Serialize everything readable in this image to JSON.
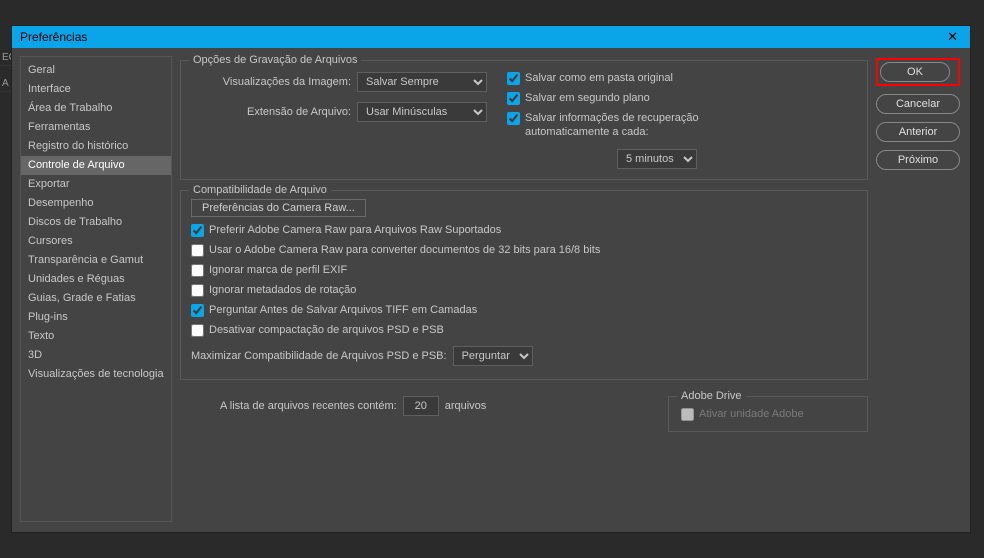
{
  "dialog": {
    "title": "Preferências"
  },
  "sidebar": {
    "items": [
      "Geral",
      "Interface",
      "Área de Trabalho",
      "Ferramentas",
      "Registro do histórico",
      "Controle de Arquivo",
      "Exportar",
      "Desempenho",
      "Discos de Trabalho",
      "Cursores",
      "Transparência e Gamut",
      "Unidades e Réguas",
      "Guias, Grade e Fatias",
      "Plug-ins",
      "Texto",
      "3D",
      "Visualizações de tecnologia"
    ],
    "selected": 5
  },
  "saveGroup": {
    "title": "Opções de Gravação de Arquivos",
    "imgPreviewLabel": "Visualizações da Imagem:",
    "imgPreviewValue": "Salvar Sempre",
    "extLabel": "Extensão de Arquivo:",
    "extValue": "Usar Minúsculas",
    "cbSaveOriginal": "Salvar como em pasta original",
    "cbSaveBg": "Salvar em segundo plano",
    "cbAutoRecover": "Salvar informações de recuperação automaticamente a cada:",
    "intervalValue": "5 minutos"
  },
  "compatGroup": {
    "title": "Compatibilidade de Arquivo",
    "cameraRawBtn": "Preferências do Camera Raw...",
    "cbPreferRaw": "Preferir Adobe Camera Raw para Arquivos Raw Suportados",
    "cbConvert3216": "Usar o Adobe Camera Raw para converter documentos de 32 bits para 16/8 bits",
    "cbIgnoreExif": "Ignorar marca de perfil EXIF",
    "cbIgnoreRotation": "Ignorar metadados de rotação",
    "cbAskTiff": "Perguntar Antes de Salvar Arquivos TIFF em Camadas",
    "cbDisablePsd": "Desativar compactação de arquivos PSD e PSB",
    "maxCompatLabel": "Maximizar Compatibilidade de Arquivos PSD e PSB:",
    "maxCompatValue": "Perguntar"
  },
  "recent": {
    "labelA": "A lista de arquivos recentes contém:",
    "value": "20",
    "labelB": "arquivos"
  },
  "drive": {
    "title": "Adobe Drive",
    "cbLabel": "Ativar unidade Adobe"
  },
  "buttons": {
    "ok": "OK",
    "cancel": "Cancelar",
    "prev": "Anterior",
    "next": "Próximo"
  },
  "edge": {
    "a": "ECE",
    "b": "A C"
  }
}
